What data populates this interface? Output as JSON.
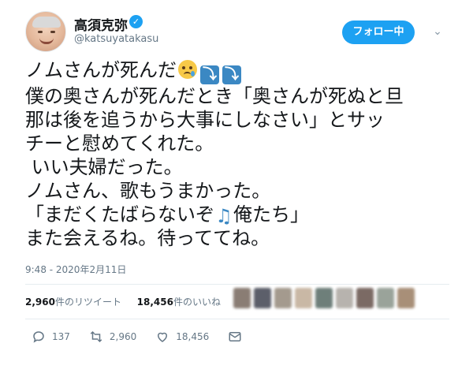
{
  "user": {
    "display_name": "高須克弥",
    "handle": "@katsuyatakasu",
    "verified_icon": "verified-badge-icon"
  },
  "header": {
    "follow_label": "フォロー中",
    "menu_icon": "chevron-down-icon"
  },
  "tweet": {
    "line1_text": "ノムさんが死んだ",
    "line1_emojis": [
      "crying-face-emoji",
      "arrow-down-emoji",
      "arrow-down-emoji"
    ],
    "line2": "僕の奥さんが死んだとき「奥さんが死ぬと旦",
    "line3": "那は後を追うから大事にしなさい」とサッ",
    "line4": "チーと慰めてくれた。",
    "line5": " いい夫婦だった。",
    "line6": "ノムさん、歌もうまかった。",
    "line7_pre": "「まだくたばらないぞ",
    "line7_post": "俺たち」",
    "line7_emoji": "musical-note-emoji",
    "line8": "また会えるね。待っててね。"
  },
  "timestamp": "9:48 - 2020年2月11日",
  "stats": {
    "retweets_count": "2,960",
    "retweets_label": "件のリツイート",
    "likes_count": "18,456",
    "likes_label": "件のいいね"
  },
  "actions": {
    "reply_count": "137",
    "retweet_count": "2,960",
    "like_count": "18,456"
  },
  "colors": {
    "accent": "#1da1f2",
    "text": "#14171a",
    "secondary": "#657786"
  }
}
